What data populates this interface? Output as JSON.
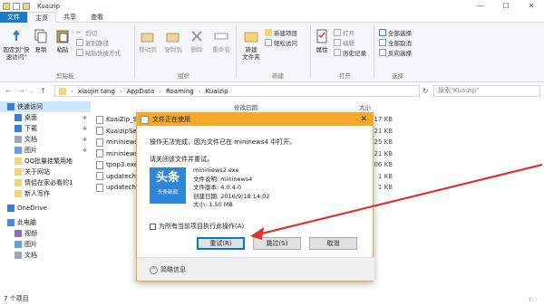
{
  "window": {
    "title": "Kuaizip",
    "tabs": [
      "文件",
      "主页",
      "共享",
      "查看"
    ]
  },
  "ribbon": {
    "clipboard": {
      "pin_label": "固定到\"快速访问\"",
      "copy": "复制",
      "paste": "粘贴",
      "cut": "剪切",
      "copy_path": "复制路径",
      "paste_shortcut": "粘贴快捷方式",
      "group": "剪贴板"
    },
    "organize": {
      "move_to": "移动到",
      "copy_to": "复制到",
      "delete": "删除",
      "rename": "重命名",
      "group": "组织"
    },
    "new": {
      "new_item": "新建项目",
      "easy_access": "轻松访问",
      "new_folder": "新建\n文件夹",
      "group": "新建"
    },
    "open": {
      "properties": "属性",
      "open": "打开",
      "edit": "编辑",
      "history": "历史记录",
      "group": "打开"
    },
    "select": {
      "select_all": "全部选择",
      "select_none": "全部取消",
      "invert": "反向选择",
      "group": "选择"
    }
  },
  "address": {
    "path": [
      "xiaojin tang",
      "AppData",
      "Roaming",
      "Kuaizip"
    ],
    "search_placeholder": "搜索\"Kuaizip\""
  },
  "nav": {
    "items": [
      {
        "label": "快速访问",
        "icon": "star-icon",
        "pinned": false
      },
      {
        "label": "桌面",
        "icon": "desktop-icon",
        "pinned": true
      },
      {
        "label": "下载",
        "icon": "download-icon",
        "pinned": true
      },
      {
        "label": "文档",
        "icon": "document-icon",
        "pinned": true
      },
      {
        "label": "图片",
        "icon": "picture-icon",
        "pinned": true
      },
      {
        "label": "QQ批量挂繁用地",
        "icon": "folder-icon",
        "pinned": false
      },
      {
        "label": "关于网站",
        "icon": "folder-icon",
        "pinned": false
      },
      {
        "label": "情侣在家必看的1",
        "icon": "folder-icon",
        "pinned": false
      },
      {
        "label": "新人写作",
        "icon": "folder-icon",
        "pinned": false
      },
      {
        "label": "OneDrive",
        "icon": "cloud-icon",
        "pinned": false
      },
      {
        "label": "此电脑",
        "icon": "computer-icon",
        "pinned": false
      },
      {
        "label": "视频",
        "icon": "video-icon",
        "pinned": false
      },
      {
        "label": "图片",
        "icon": "picture-icon",
        "pinned": false
      },
      {
        "label": "文档",
        "icon": "document-icon",
        "pinned": false
      }
    ]
  },
  "files": {
    "col_modified": "修改日期",
    "col_size": "大小",
    "rows": [
      {
        "name": "KuaiZip_S",
        "size": "317 KB"
      },
      {
        "name": "KuaizipSe",
        "size": "621 KB"
      },
      {
        "name": "mininiews",
        "size": "625 KB"
      },
      {
        "name": "mininiews",
        "size": "621 KB"
      },
      {
        "name": "tpop3.exe",
        "size": "906 KB"
      },
      {
        "name": "updatechi",
        "size": "1 KB"
      },
      {
        "name": "updatechi",
        "size": "1 KB"
      }
    ]
  },
  "status": {
    "count": "7 个项目"
  },
  "dialog": {
    "title": "文件正在使用",
    "message": "操作无法完成，因为文件已在 mininews4 中打开。",
    "hint": "请关闭该文件并重试。",
    "file": {
      "name": "mininiews2.exe",
      "description": "文件说明: mininews4",
      "version": "文件版本: 4.0.4.0",
      "created": "创建日期: 2016/9/18 14:02",
      "size": "大小: 1.50 MB"
    },
    "app_icon_text": "头条",
    "app_icon_sub": "头条新闻",
    "checkbox_label": "为所有当前项目执行此操作(A)",
    "retry": "重试(R)",
    "skip": "跳过(S)",
    "cancel": "取消",
    "more_info": "简略信息"
  },
  "colors": {
    "accent": "#1979ca",
    "dialog_title": "#f4a929",
    "arrow": "#e0322f",
    "app_icon": "#2f86d8"
  }
}
